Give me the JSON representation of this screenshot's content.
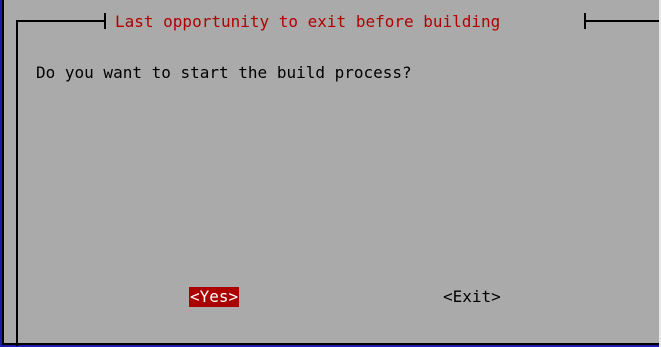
{
  "dialog": {
    "title": "Last opportunity to exit before building",
    "message": "Do you want to start the build process?",
    "buttons": {
      "yes_label": "<Yes>",
      "exit_label": "<Exit>"
    },
    "selected_button": "yes"
  },
  "colors": {
    "background": "#1c1ca8",
    "dialog_bg": "#aaaaaa",
    "title_text": "#b00000",
    "selected_bg": "#aa0000",
    "selected_text": "#ffffff"
  }
}
